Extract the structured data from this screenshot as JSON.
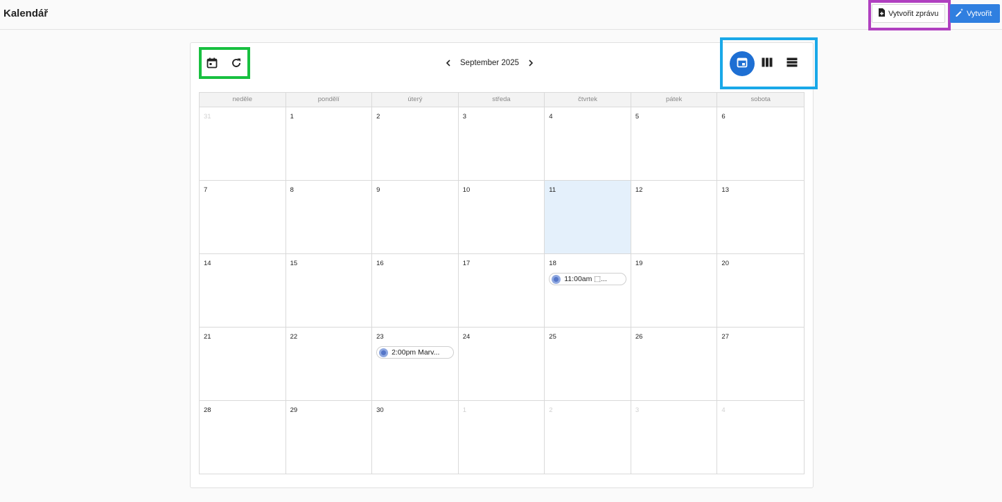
{
  "header": {
    "title": "Kalendář",
    "report_button": "Vytvořit zprávu",
    "create_button": "Vytvořit"
  },
  "calendar": {
    "month_label": "September 2025",
    "weekdays": [
      "neděle",
      "pondělí",
      "úterý",
      "středa",
      "čtvrtek",
      "pátek",
      "sobota"
    ],
    "weeks": [
      [
        {
          "d": "31",
          "other": true
        },
        {
          "d": "1"
        },
        {
          "d": "2"
        },
        {
          "d": "3"
        },
        {
          "d": "4"
        },
        {
          "d": "5"
        },
        {
          "d": "6"
        }
      ],
      [
        {
          "d": "7"
        },
        {
          "d": "8"
        },
        {
          "d": "9"
        },
        {
          "d": "10"
        },
        {
          "d": "11",
          "today": true
        },
        {
          "d": "12"
        },
        {
          "d": "13"
        }
      ],
      [
        {
          "d": "14"
        },
        {
          "d": "15"
        },
        {
          "d": "16"
        },
        {
          "d": "17"
        },
        {
          "d": "18",
          "event": "11:00am  ⬚..."
        },
        {
          "d": "19"
        },
        {
          "d": "20"
        }
      ],
      [
        {
          "d": "21"
        },
        {
          "d": "22"
        },
        {
          "d": "23",
          "event": "2:00pm  Marv..."
        },
        {
          "d": "24"
        },
        {
          "d": "25"
        },
        {
          "d": "26"
        },
        {
          "d": "27"
        }
      ],
      [
        {
          "d": "28"
        },
        {
          "d": "29"
        },
        {
          "d": "30"
        },
        {
          "d": "1",
          "other": true
        },
        {
          "d": "2",
          "other": true
        },
        {
          "d": "3",
          "other": true
        },
        {
          "d": "4",
          "other": true
        }
      ]
    ]
  },
  "icons": {
    "today": "calendar-today-icon",
    "refresh": "refresh-icon",
    "prev": "chevron-left-icon",
    "next": "chevron-right-icon",
    "month_view": "calendar-month-icon",
    "week_view": "view-week-icon",
    "day_view": "view-day-icon",
    "report": "document-add-icon",
    "create": "edit-magic-icon"
  },
  "colors": {
    "accent": "#2f7fe0",
    "today_bg": "#e4f0fb",
    "highlight_report": "#b040c0",
    "highlight_tools": "#18c040",
    "highlight_views": "#19a8e8"
  }
}
